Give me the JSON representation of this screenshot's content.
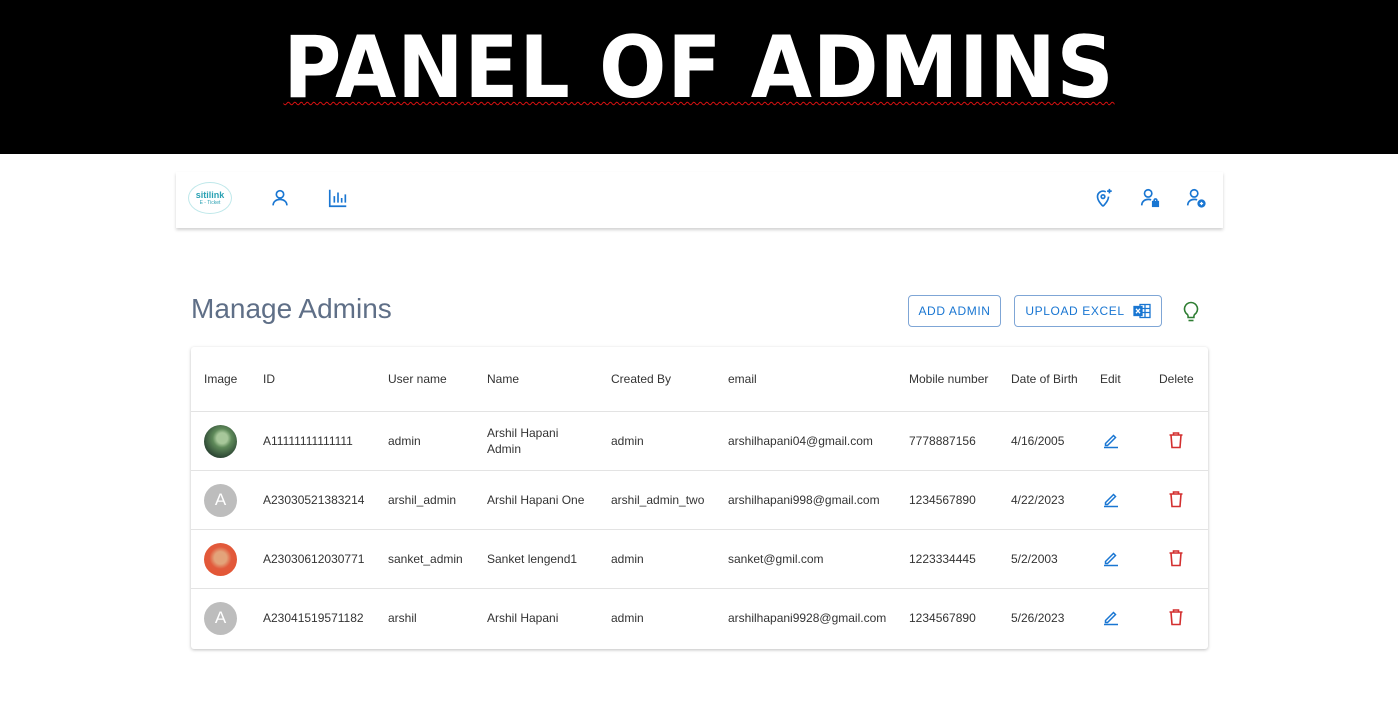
{
  "banner": {
    "title": "PANEL OF ADMINS"
  },
  "navbar": {
    "logo": {
      "main": "sitilink",
      "sub": "E - Ticket"
    }
  },
  "page": {
    "title": "Manage Admins",
    "add_admin_label": "ADD ADMIN",
    "upload_excel_label": "UPLOAD EXCEL"
  },
  "table": {
    "headers": {
      "image": "Image",
      "id": "ID",
      "username": "User name",
      "name": "Name",
      "created_by": "Created By",
      "email": "email",
      "mobile": "Mobile number",
      "dob": "Date of Birth",
      "edit": "Edit",
      "delete": "Delete"
    },
    "rows": [
      {
        "avatar": "",
        "id": "A11111111111111",
        "username": "admin",
        "name": "Arshil Hapani Admin",
        "created_by": "admin",
        "email": "arshilhapani04@gmail.com",
        "mobile": "7778887156",
        "dob": "4/16/2005"
      },
      {
        "avatar": "A",
        "id": "A23030521383214",
        "username": "arshil_admin",
        "name": "Arshil Hapani One",
        "created_by": "arshil_admin_two",
        "email": "arshilhapani998@gmail.com",
        "mobile": "1234567890",
        "dob": "4/22/2023"
      },
      {
        "avatar": "",
        "id": "A23030612030771",
        "username": "sanket_admin",
        "name": "Sanket lengend1",
        "created_by": "admin",
        "email": "sanket@gmil.com",
        "mobile": "1223334445",
        "dob": "5/2/2003"
      },
      {
        "avatar": "A",
        "id": "A23041519571182",
        "username": "arshil",
        "name": "Arshil Hapani",
        "created_by": "admin",
        "email": "arshilhapani9928@gmail.com",
        "mobile": "1234567890",
        "dob": "5/26/2023"
      }
    ]
  },
  "colors": {
    "accent": "#1976d2",
    "danger": "#d32f2f",
    "title": "#5f6f87",
    "bulb": "#2e7d32"
  },
  "icons": [
    "person-icon",
    "bar-chart-icon",
    "add-location-icon",
    "person-lock-icon",
    "person-add-icon",
    "excel-icon",
    "lightbulb-icon",
    "edit-icon",
    "delete-icon"
  ]
}
